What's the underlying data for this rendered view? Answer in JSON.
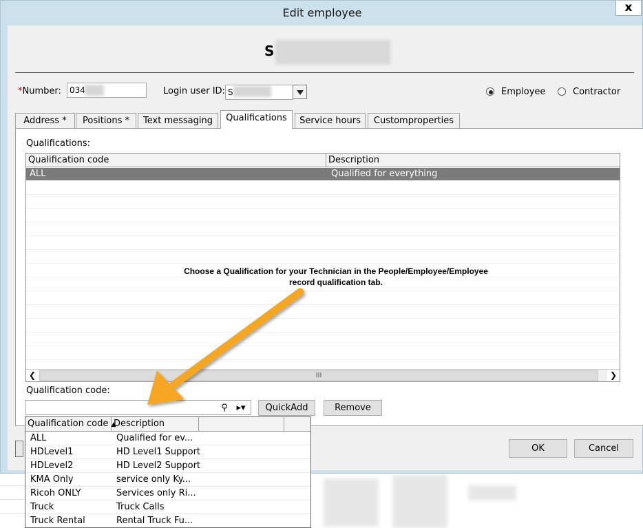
{
  "window": {
    "title": "Edit employee",
    "close_label": "x"
  },
  "employee": {
    "name_initial": "S",
    "number_required_mark": "*",
    "number_label": "Number:",
    "number_value": "034",
    "login_label": "Login user ID:",
    "login_value": "S",
    "type_options": [
      "Employee",
      "Contractor"
    ],
    "type_selected": "Employee"
  },
  "tabs": [
    {
      "label": "Address *"
    },
    {
      "label": "Positions *"
    },
    {
      "label": "Text messaging"
    },
    {
      "label": "Qualifications",
      "active": true
    },
    {
      "label": "Service hours"
    },
    {
      "label": "Customproperties"
    }
  ],
  "qualifications": {
    "section_label": "Qualifications:",
    "columns": [
      "Qualification code",
      "Description"
    ],
    "rows": [
      {
        "code": "ALL",
        "description": "Qualified for everything",
        "selected": true
      }
    ],
    "scroll_thumb": "III"
  },
  "annotation": {
    "line1": "Choose a Qualification for your Technician in the People/Employee/Employee",
    "line2": "record qualification tab.",
    "arrow_color": "#f5a623"
  },
  "qual_code": {
    "label": "Qualification code:",
    "value": "",
    "quickadd_label": "QuickAdd",
    "remove_label": "Remove"
  },
  "dropdown": {
    "columns": [
      "Qualification code",
      "Description"
    ],
    "sort_indicator": "▲",
    "items": [
      {
        "code": "ALL",
        "description": "Qualified for ev..."
      },
      {
        "code": "HDLevel1",
        "description": "HD Level1 Support"
      },
      {
        "code": "HDLevel2",
        "description": "HD Level2 Support"
      },
      {
        "code": "KMA Only",
        "description": "service only Ky..."
      },
      {
        "code": "Ricoh ONLY",
        "description": "Services only Ri..."
      },
      {
        "code": "Truck",
        "description": "Truck Calls"
      },
      {
        "code": "Truck Rental",
        "description": "Rental Truck Fu..."
      }
    ]
  },
  "buttons": {
    "ok_label": "OK",
    "cancel_label": "Cancel"
  },
  "colors": {
    "selected_row": "#7a7a7a",
    "title_bar": "#cde1ec",
    "required": "#c00000"
  }
}
